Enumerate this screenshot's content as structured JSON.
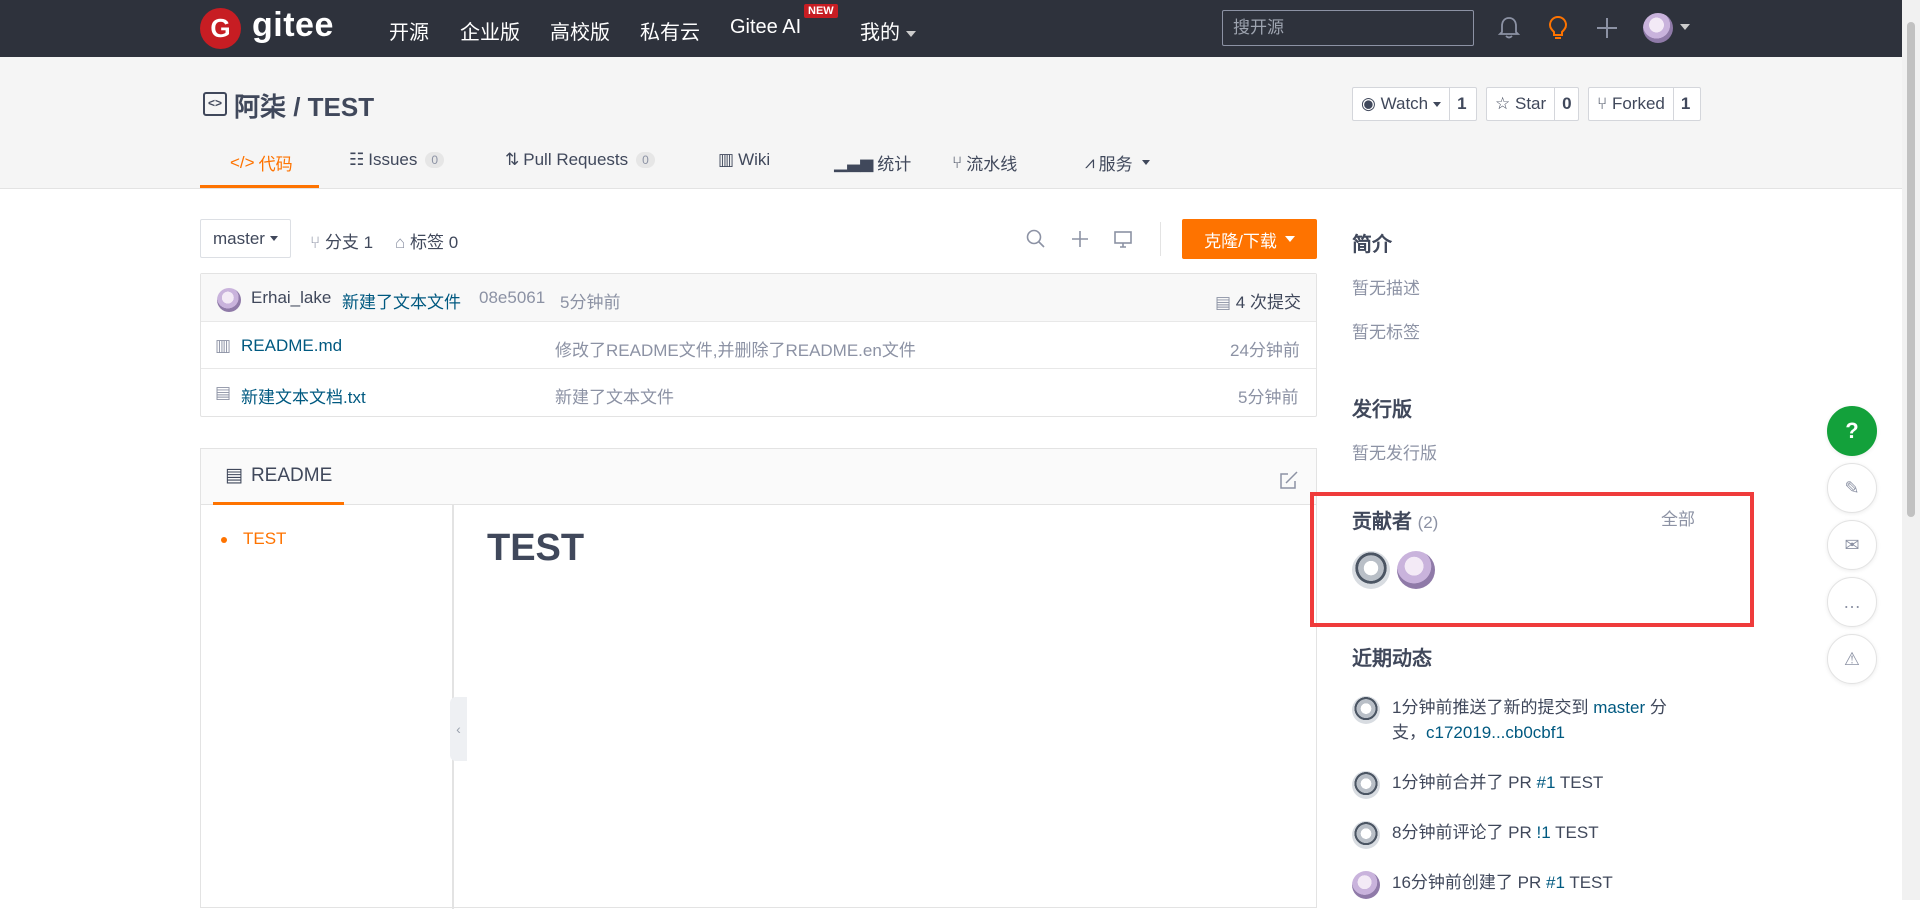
{
  "topnav": {
    "logo_letter": "G",
    "logo_text": "gitee",
    "links": [
      "开源",
      "企业版",
      "高校版",
      "私有云",
      "Gitee AI",
      "我的"
    ],
    "new_badge": "NEW",
    "search_placeholder": "搜开源"
  },
  "repo": {
    "title": "阿柒 / TEST",
    "watch": {
      "label": "Watch",
      "count": "1"
    },
    "star": {
      "label": "Star",
      "count": "0"
    },
    "forked": {
      "label": "Forked",
      "count": "1"
    },
    "tabs": {
      "code": "代码",
      "issues": "Issues",
      "issues_count": "0",
      "pull_requests": "Pull Requests",
      "pr_count": "0",
      "wiki": "Wiki",
      "stats": "统计",
      "pipeline": "流水线",
      "services": "服务"
    }
  },
  "branchbar": {
    "branch": "master",
    "branches": "分支 1",
    "tags": "标签 0",
    "clone_label": "克隆/下载"
  },
  "commit": {
    "author": "Erhai_lake",
    "message": "新建了文本文件",
    "hash": "08e5061",
    "time": "5分钟前",
    "count": "4 次提交"
  },
  "files": [
    {
      "name": "README.md",
      "message": "修改了README文件,并删除了README.en文件",
      "time": "24分钟前"
    },
    {
      "name": "新建文本文档.txt",
      "message": "新建了文本文件",
      "time": "5分钟前"
    }
  ],
  "readme": {
    "tab_label": "README",
    "toc_item": "TEST",
    "heading": "TEST"
  },
  "sidebar": {
    "intro_title": "简介",
    "no_desc": "暂无描述",
    "no_tags": "暂无标签",
    "release_title": "发行版",
    "no_release": "暂无发行版",
    "contributors_title": "贡献者",
    "contributors_count": "(2)",
    "all_link": "全部",
    "activity_title": "近期动态",
    "activities": [
      {
        "prefix": "1分钟前推送了新的提交到 ",
        "link": "master",
        "mid": " 分支，",
        "link2": "c172019...cb0cbf1"
      },
      {
        "prefix": "1分钟前合并了 PR ",
        "link": "#1",
        "suffix": " TEST"
      },
      {
        "prefix": "8分钟前评论了 PR ",
        "link": "!1",
        "suffix": " TEST"
      },
      {
        "prefix": "16分钟前创建了 PR ",
        "link": "#1",
        "suffix": " TEST"
      }
    ]
  },
  "floating": {
    "help": "?"
  },
  "colors": {
    "accent": "#fe7300",
    "nav_bg": "#2e323c",
    "brand": "#c71d23",
    "link": "#005980",
    "highlight_box": "#ef3b3b",
    "help_green": "#13a13b"
  }
}
